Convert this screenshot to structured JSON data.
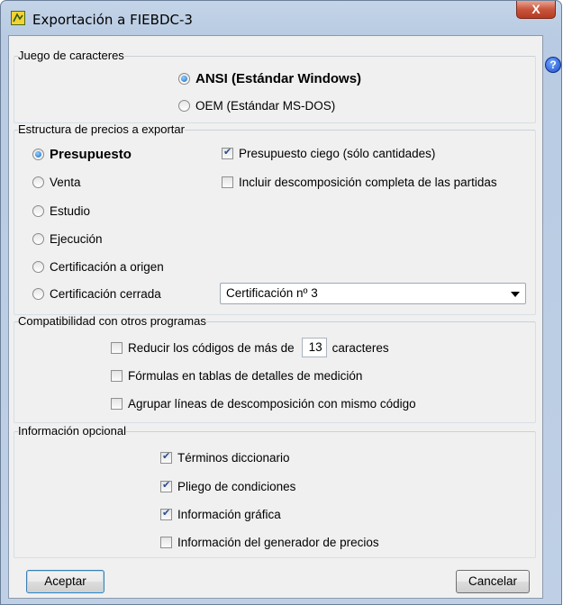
{
  "window": {
    "title": "Exportación a FIEBDC-3",
    "close_label": "X",
    "help_label": "?"
  },
  "charset": {
    "legend": "Juego de caracteres",
    "options": [
      {
        "label": "ANSI (Estándar Windows)",
        "selected": true
      },
      {
        "label": "OEM (Estándar MS-DOS)",
        "selected": false
      }
    ]
  },
  "prices": {
    "legend": "Estructura de precios a exportar",
    "options": [
      {
        "label": "Presupuesto",
        "selected": true
      },
      {
        "label": "Venta",
        "selected": false
      },
      {
        "label": "Estudio",
        "selected": false
      },
      {
        "label": "Ejecución",
        "selected": false
      },
      {
        "label": "Certificación a origen",
        "selected": false
      },
      {
        "label": "Certificación cerrada",
        "selected": false
      }
    ],
    "checks": [
      {
        "label": "Presupuesto ciego (sólo cantidades)",
        "checked": true
      },
      {
        "label": "Incluir descomposición completa de las partidas",
        "checked": false
      }
    ],
    "cert_select_value": "Certificación nº 3"
  },
  "compat": {
    "legend": "Compatibilidad con otros programas",
    "reduce_label": "Reducir los códigos de más de",
    "reduce_value": "13",
    "reduce_suffix": "caracteres",
    "reduce_checked": false,
    "formulas_label": "Fórmulas en tablas de detalles de medición",
    "formulas_checked": false,
    "group_label": "Agrupar líneas de descomposición con mismo código",
    "group_checked": false
  },
  "optional": {
    "legend": "Información opcional",
    "items": [
      {
        "label": "Términos diccionario",
        "checked": true
      },
      {
        "label": "Pliego de condiciones",
        "checked": true
      },
      {
        "label": "Información gráfica",
        "checked": true
      },
      {
        "label": "Información del generador de precios",
        "checked": false
      }
    ]
  },
  "buttons": {
    "accept": "Aceptar",
    "cancel": "Cancelar"
  }
}
